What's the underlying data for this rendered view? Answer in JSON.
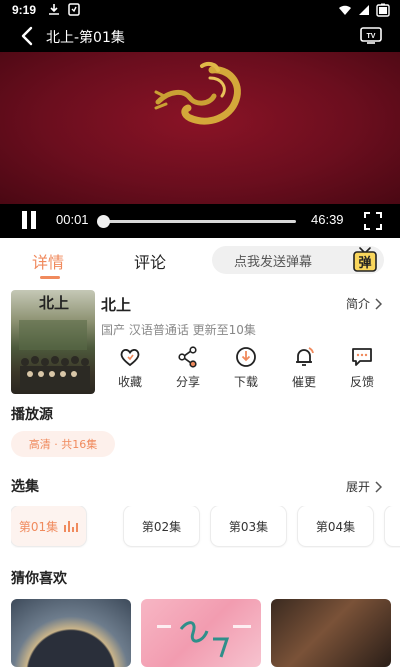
{
  "status_bar": {
    "time": "9:19",
    "left_icons": [
      "download-icon",
      "notification-icon"
    ],
    "right_icons": [
      "wifi-icon",
      "signal-icon",
      "battery-icon"
    ]
  },
  "top_bar": {
    "title": "北上-第01集",
    "back_icon": "back-arrow-icon",
    "cast_icon": "tv-cast-icon"
  },
  "player": {
    "current_time": "00:01",
    "duration": "46:39",
    "progress_fraction": 0.005,
    "state": "playing",
    "accent": "#f08a5d"
  },
  "tabs": {
    "items": [
      {
        "label": "详情",
        "active": true
      },
      {
        "label": "评论",
        "active": false
      }
    ],
    "danmu_placeholder": "点我发送弹幕",
    "danmu_badge": "弹"
  },
  "show": {
    "poster_text": "北上",
    "title": "北上",
    "intro_label": "简介",
    "meta": "国产 汉语普通话 更新至10集",
    "actions": [
      {
        "label": "收藏",
        "icon": "heart-icon"
      },
      {
        "label": "分享",
        "icon": "share-icon"
      },
      {
        "label": "下载",
        "icon": "download-icon"
      },
      {
        "label": "催更",
        "icon": "bell-icon"
      },
      {
        "label": "反馈",
        "icon": "feedback-icon"
      }
    ]
  },
  "source": {
    "title": "播放源",
    "chip": "高清 · 共16集"
  },
  "episodes": {
    "title": "选集",
    "expand_label": "展开",
    "items": [
      {
        "label": "第01集",
        "active": true
      },
      {
        "label": "第02集",
        "active": false
      },
      {
        "label": "第03集",
        "active": false
      },
      {
        "label": "第04集",
        "active": false
      }
    ]
  },
  "recommend": {
    "title": "猜你喜欢"
  }
}
